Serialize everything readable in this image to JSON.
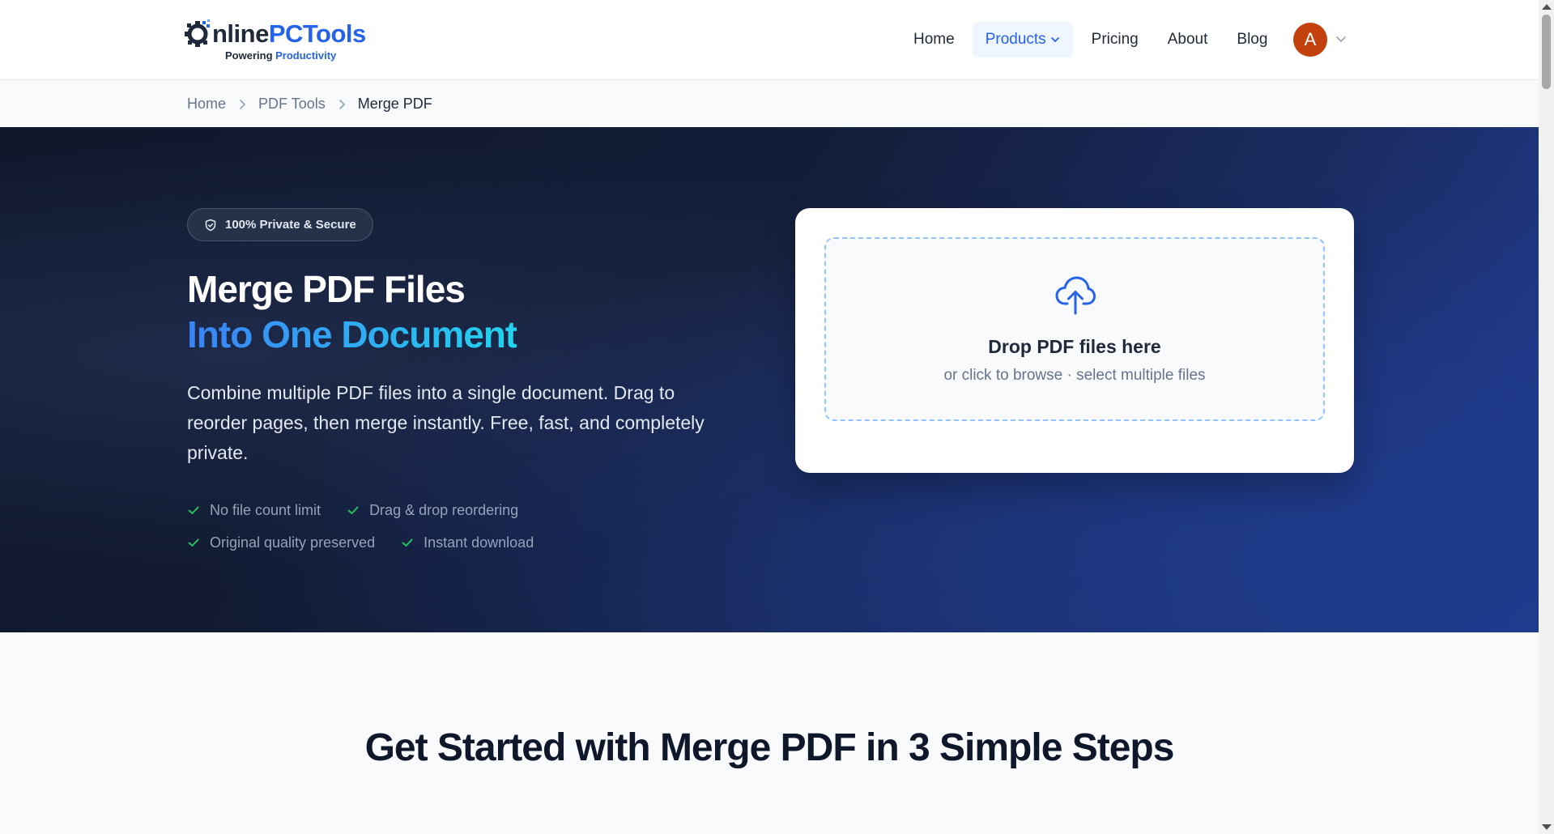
{
  "header": {
    "logo": {
      "brand_part1": "nline",
      "brand_part2": "PCTools",
      "tagline_part1": "Powering ",
      "tagline_part2": "Productivity"
    },
    "nav": {
      "home": "Home",
      "products": "Products",
      "pricing": "Pricing",
      "about": "About",
      "blog": "Blog"
    },
    "avatar_initial": "A"
  },
  "breadcrumb": {
    "home": "Home",
    "category": "PDF Tools",
    "current": "Merge PDF"
  },
  "hero": {
    "badge": "100% Private & Secure",
    "title_line1": "Merge PDF Files",
    "title_line2": "Into One Document",
    "description": "Combine multiple PDF files into a single document. Drag to reorder pages, then merge instantly. Free, fast, and completely private.",
    "features": [
      "No file count limit",
      "Drag & drop reordering",
      "Original quality preserved",
      "Instant download"
    ]
  },
  "upload": {
    "title": "Drop PDF files here",
    "subtitle": "or click to browse · select multiple files"
  },
  "steps": {
    "title": "Get Started with Merge PDF in 3 Simple Steps"
  },
  "colors": {
    "accent": "#2563eb",
    "hero_bg": "#0f172a",
    "check": "#22c55e",
    "avatar": "#c2410c"
  }
}
